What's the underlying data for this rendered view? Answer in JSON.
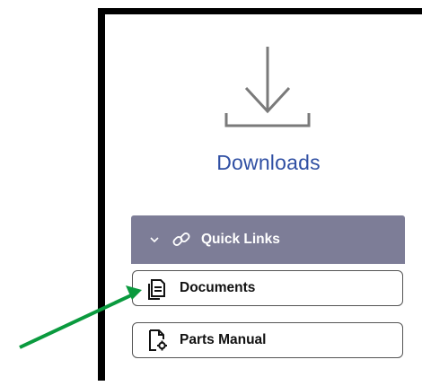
{
  "downloads": {
    "label": "Downloads",
    "icon": "download-icon",
    "color": "#2f4fa3"
  },
  "quick_links": {
    "title": "Quick Links",
    "header_color": "#7d7d97",
    "icons": [
      "chevron-down-icon",
      "link-icon"
    ],
    "items": [
      {
        "label": "Documents",
        "icon": "document-icon"
      },
      {
        "label": "Parts Manual",
        "icon": "file-gear-icon"
      }
    ]
  },
  "annotation": {
    "icon": "arrow-icon",
    "color": "#0a9a3e"
  }
}
